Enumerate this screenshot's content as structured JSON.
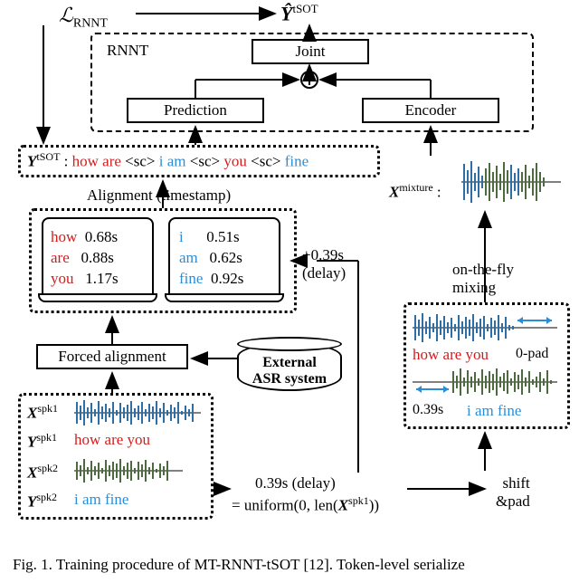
{
  "loss": "ℒ",
  "loss_sub": "RNNT",
  "yhat": "Ŷ",
  "yhat_sup": "tSOT",
  "rnnt_label": "RNNT",
  "joint": "Joint",
  "prediction": "Prediction",
  "encoder": "Encoder",
  "ytsot_var": "Y",
  "ytsot_sup": "tSOT",
  "ytsot_colon": ":",
  "ytsot_tokens": {
    "t1": "how are",
    "sc1": "<sc>",
    "t2": "i am",
    "sc2": "<sc>",
    "t3": "you",
    "sc3": "<sc>",
    "t4": "fine"
  },
  "align_label": "Alignment (timestamp)",
  "align_left": {
    "r1w": "how",
    "r1t": "0.68s",
    "r2w": "are",
    "r2t": "0.88s",
    "r3w": "you",
    "r3t": "1.17s"
  },
  "align_right": {
    "r1w": "i",
    "r1t": "0.51s",
    "r2w": "am",
    "r2t": "0.62s",
    "r3w": "fine",
    "r3t": "0.92s"
  },
  "delay_align": "+0.39s\n(delay)",
  "forced": "Forced alignment",
  "xmix_var": "X",
  "xmix_sup": "mixture",
  "xmix_colon": ":",
  "on_the_fly": "on-the-fly\nmixing",
  "mixing_box": {
    "top_label": "how are you",
    "top_right": "0-pad",
    "bot_left": "0.39s",
    "bot_label": "i am fine"
  },
  "shift_pad": "shift\n&pad",
  "xspk1_var": "X",
  "xspk1_sup": "spk1",
  "yspk1_var": "Y",
  "yspk1_sup": "spk1",
  "xspk2_var": "X",
  "xspk2_sup": "spk2",
  "yspk2_var": "Y",
  "yspk2_sup": "spk2",
  "yspk1_text": "how are you",
  "yspk2_text": "i am fine",
  "ext_asr": "External\nASR system",
  "delay_formula_1": "0.39s (delay)",
  "delay_formula_2a": "= uniform(0, len(",
  "delay_formula_2b_var": "X",
  "delay_formula_2b_sup": "spk1",
  "delay_formula_2c": "))",
  "caption": "Fig. 1.   Training procedure of MT-RNNT-tSOT [12]. Token-level serialize"
}
